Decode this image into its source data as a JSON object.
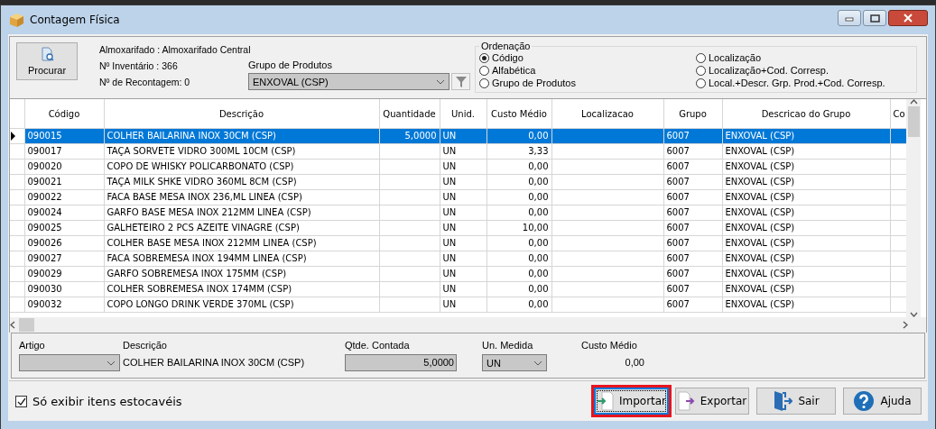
{
  "window": {
    "title": "Contagem Física"
  },
  "header": {
    "search_button": "Procurar",
    "info": [
      "Almoxarifado : Almoxarifado Central",
      "Nº Inventário : 366",
      "Nº de Recontagem: 0"
    ],
    "product_group": {
      "label": "Grupo de Produtos",
      "value": "ENXOVAL (CSP)"
    }
  },
  "sort": {
    "title": "Ordenação",
    "options": [
      {
        "label": "Código",
        "selected": true
      },
      {
        "label": "Alfabética",
        "selected": false
      },
      {
        "label": "Grupo de Produtos",
        "selected": false
      },
      {
        "label": "Localização",
        "selected": false
      },
      {
        "label": "Localização+Cod. Corresp.",
        "selected": false
      },
      {
        "label": "Local.+Descr. Grp. Prod.+Cod. Corresp.",
        "selected": false
      }
    ]
  },
  "table": {
    "columns": [
      "Código",
      "Descrição",
      "Quantidade",
      "Unid.",
      "Custo Médio",
      "Localizacao",
      "Grupo",
      "Descricao do Grupo",
      "Co"
    ],
    "rows": [
      {
        "selected": true,
        "code": "090015",
        "description": "COLHER BAILARINA INOX 30CM (CSP)",
        "quantity": "5,0000",
        "unit": "UN",
        "avg_cost": "0,00",
        "group": "6007",
        "group_description": "ENXOVAL (CSP)"
      },
      {
        "selected": false,
        "code": "090017",
        "description": "TAÇA SORVETE VIDRO 300ML 10CM (CSP)",
        "unit": "UN",
        "avg_cost": "3,33",
        "group": "6007",
        "group_description": "ENXOVAL (CSP)"
      },
      {
        "selected": false,
        "code": "090020",
        "description": "COPO DE WHISKY POLICARBONATO (CSP)",
        "unit": "UN",
        "avg_cost": "0,00",
        "group": "6007",
        "group_description": "ENXOVAL (CSP)"
      },
      {
        "selected": false,
        "code": "090021",
        "description": "TAÇA MILK SHKE VIDRO 360ML 8CM (CSP)",
        "unit": "UN",
        "avg_cost": "0,00",
        "group": "6007",
        "group_description": "ENXOVAL (CSP)"
      },
      {
        "selected": false,
        "code": "090022",
        "description": "FACA BASE MESA INOX 236,ML LINEA (CSP)",
        "unit": "UN",
        "avg_cost": "0,00",
        "group": "6007",
        "group_description": "ENXOVAL (CSP)"
      },
      {
        "selected": false,
        "code": "090024",
        "description": "GARFO BASE MESA INOX 212MM LINEA (CSP)",
        "unit": "UN",
        "avg_cost": "0,00",
        "group": "6007",
        "group_description": "ENXOVAL (CSP)"
      },
      {
        "selected": false,
        "code": "090025",
        "description": "GALHETEIRO 2 PCS AZEITE VINAGRE (CSP)",
        "unit": "UN",
        "avg_cost": "10,00",
        "group": "6007",
        "group_description": "ENXOVAL (CSP)"
      },
      {
        "selected": false,
        "code": "090026",
        "description": "COLHER BASE MESA INOX 212MM LINEA (CSP)",
        "unit": "UN",
        "avg_cost": "0,00",
        "group": "6007",
        "group_description": "ENXOVAL (CSP)"
      },
      {
        "selected": false,
        "code": "090027",
        "description": "FACA SOBREMESA INOX 194MM LINEA (CSP)",
        "unit": "UN",
        "avg_cost": "0,00",
        "group": "6007",
        "group_description": "ENXOVAL (CSP)"
      },
      {
        "selected": false,
        "code": "090029",
        "description": "GARFO SOBREMESA INOX 175MM (CSP)",
        "unit": "UN",
        "avg_cost": "0,00",
        "group": "6007",
        "group_description": "ENXOVAL (CSP)"
      },
      {
        "selected": false,
        "code": "090030",
        "description": "COLHER SOBREMESA INOX 174MM (CSP)",
        "unit": "UN",
        "avg_cost": "0,00",
        "group": "6007",
        "group_description": "ENXOVAL (CSP)"
      },
      {
        "selected": false,
        "code": "090032",
        "description": "COPO LONGO DRINK VERDE 370ML (CSP)",
        "unit": "UN",
        "avg_cost": "0,00",
        "group": "6007",
        "group_description": "ENXOVAL (CSP)"
      }
    ]
  },
  "detail": {
    "article": {
      "label": "Artigo"
    },
    "description": {
      "label": "Descrição",
      "value": "COLHER BAILARINA INOX 30CM (CSP)"
    },
    "counted_qty": {
      "label": "Qtde. Contada",
      "value": "5,0000"
    },
    "unit": {
      "label": "Un. Medida",
      "value": "UN"
    },
    "avg_cost": {
      "label": "Custo Médio",
      "value": "0,00"
    }
  },
  "footer": {
    "stockable_only": {
      "label": "Só exibir itens estocavéis",
      "checked": true
    },
    "buttons": [
      {
        "label": "Importar",
        "kind": "import",
        "highlighted": true
      },
      {
        "label": "Exportar",
        "kind": "export",
        "highlighted": false
      },
      {
        "label": "Sair",
        "kind": "exit",
        "highlighted": false
      },
      {
        "label": "Ajuda",
        "kind": "help",
        "highlighted": false
      }
    ]
  }
}
